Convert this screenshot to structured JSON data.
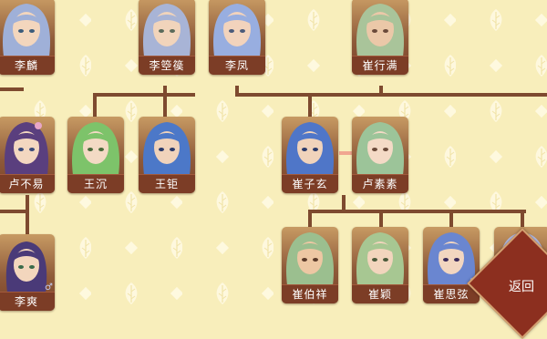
{
  "colors": {
    "background": "#f8eebb",
    "line": "#7e4a2f",
    "spouse_link": "#f0a690",
    "card_plate": "#7c3d26",
    "return_button": "#8c2f1f"
  },
  "characters": [
    {
      "name": "李麟",
      "hair": "#9fb0d8",
      "skin": "#f3d6bd",
      "gender": ""
    },
    {
      "name": "李箜篌",
      "hair": "#a8b4d6",
      "skin": "#f1d4bb",
      "gender": ""
    },
    {
      "name": "李凤",
      "hair": "#98aee0",
      "skin": "#f2d3bc",
      "gender": ""
    },
    {
      "name": "崔行满",
      "hair": "#a9c49a",
      "skin": "#ebc8a8",
      "gender": ""
    },
    {
      "name": "卢不易",
      "hair": "#5a3f7e",
      "skin": "#f3d7c0",
      "gender": ""
    },
    {
      "name": "王沉",
      "hair": "#7dc36a",
      "skin": "#f3dac4",
      "gender": ""
    },
    {
      "name": "王钜",
      "hair": "#4c78c8",
      "skin": "#f0d3bb",
      "gender": ""
    },
    {
      "name": "崔子玄",
      "hair": "#4f76c8",
      "skin": "#f0d3bb",
      "gender": ""
    },
    {
      "name": "卢素素",
      "hair": "#9cc499",
      "skin": "#f4dac6",
      "gender": ""
    },
    {
      "name": "李爽",
      "hair": "#4a3a78",
      "skin": "#f3d6bd",
      "gender": "♂"
    },
    {
      "name": "崔伯祥",
      "hair": "#9bbf8f",
      "skin": "#edc7a3",
      "gender": ""
    },
    {
      "name": "崔颖",
      "hair": "#a7c792",
      "skin": "#f2d5bd",
      "gender": ""
    },
    {
      "name": "崔思弦",
      "hair": "#6a86d0",
      "skin": "#f2d6c0",
      "gender": "♂"
    },
    {
      "name": "",
      "hair": "#b4bde4",
      "skin": "#f3d8c2",
      "gender": ""
    }
  ],
  "buttons": {
    "return_label": "返回"
  }
}
